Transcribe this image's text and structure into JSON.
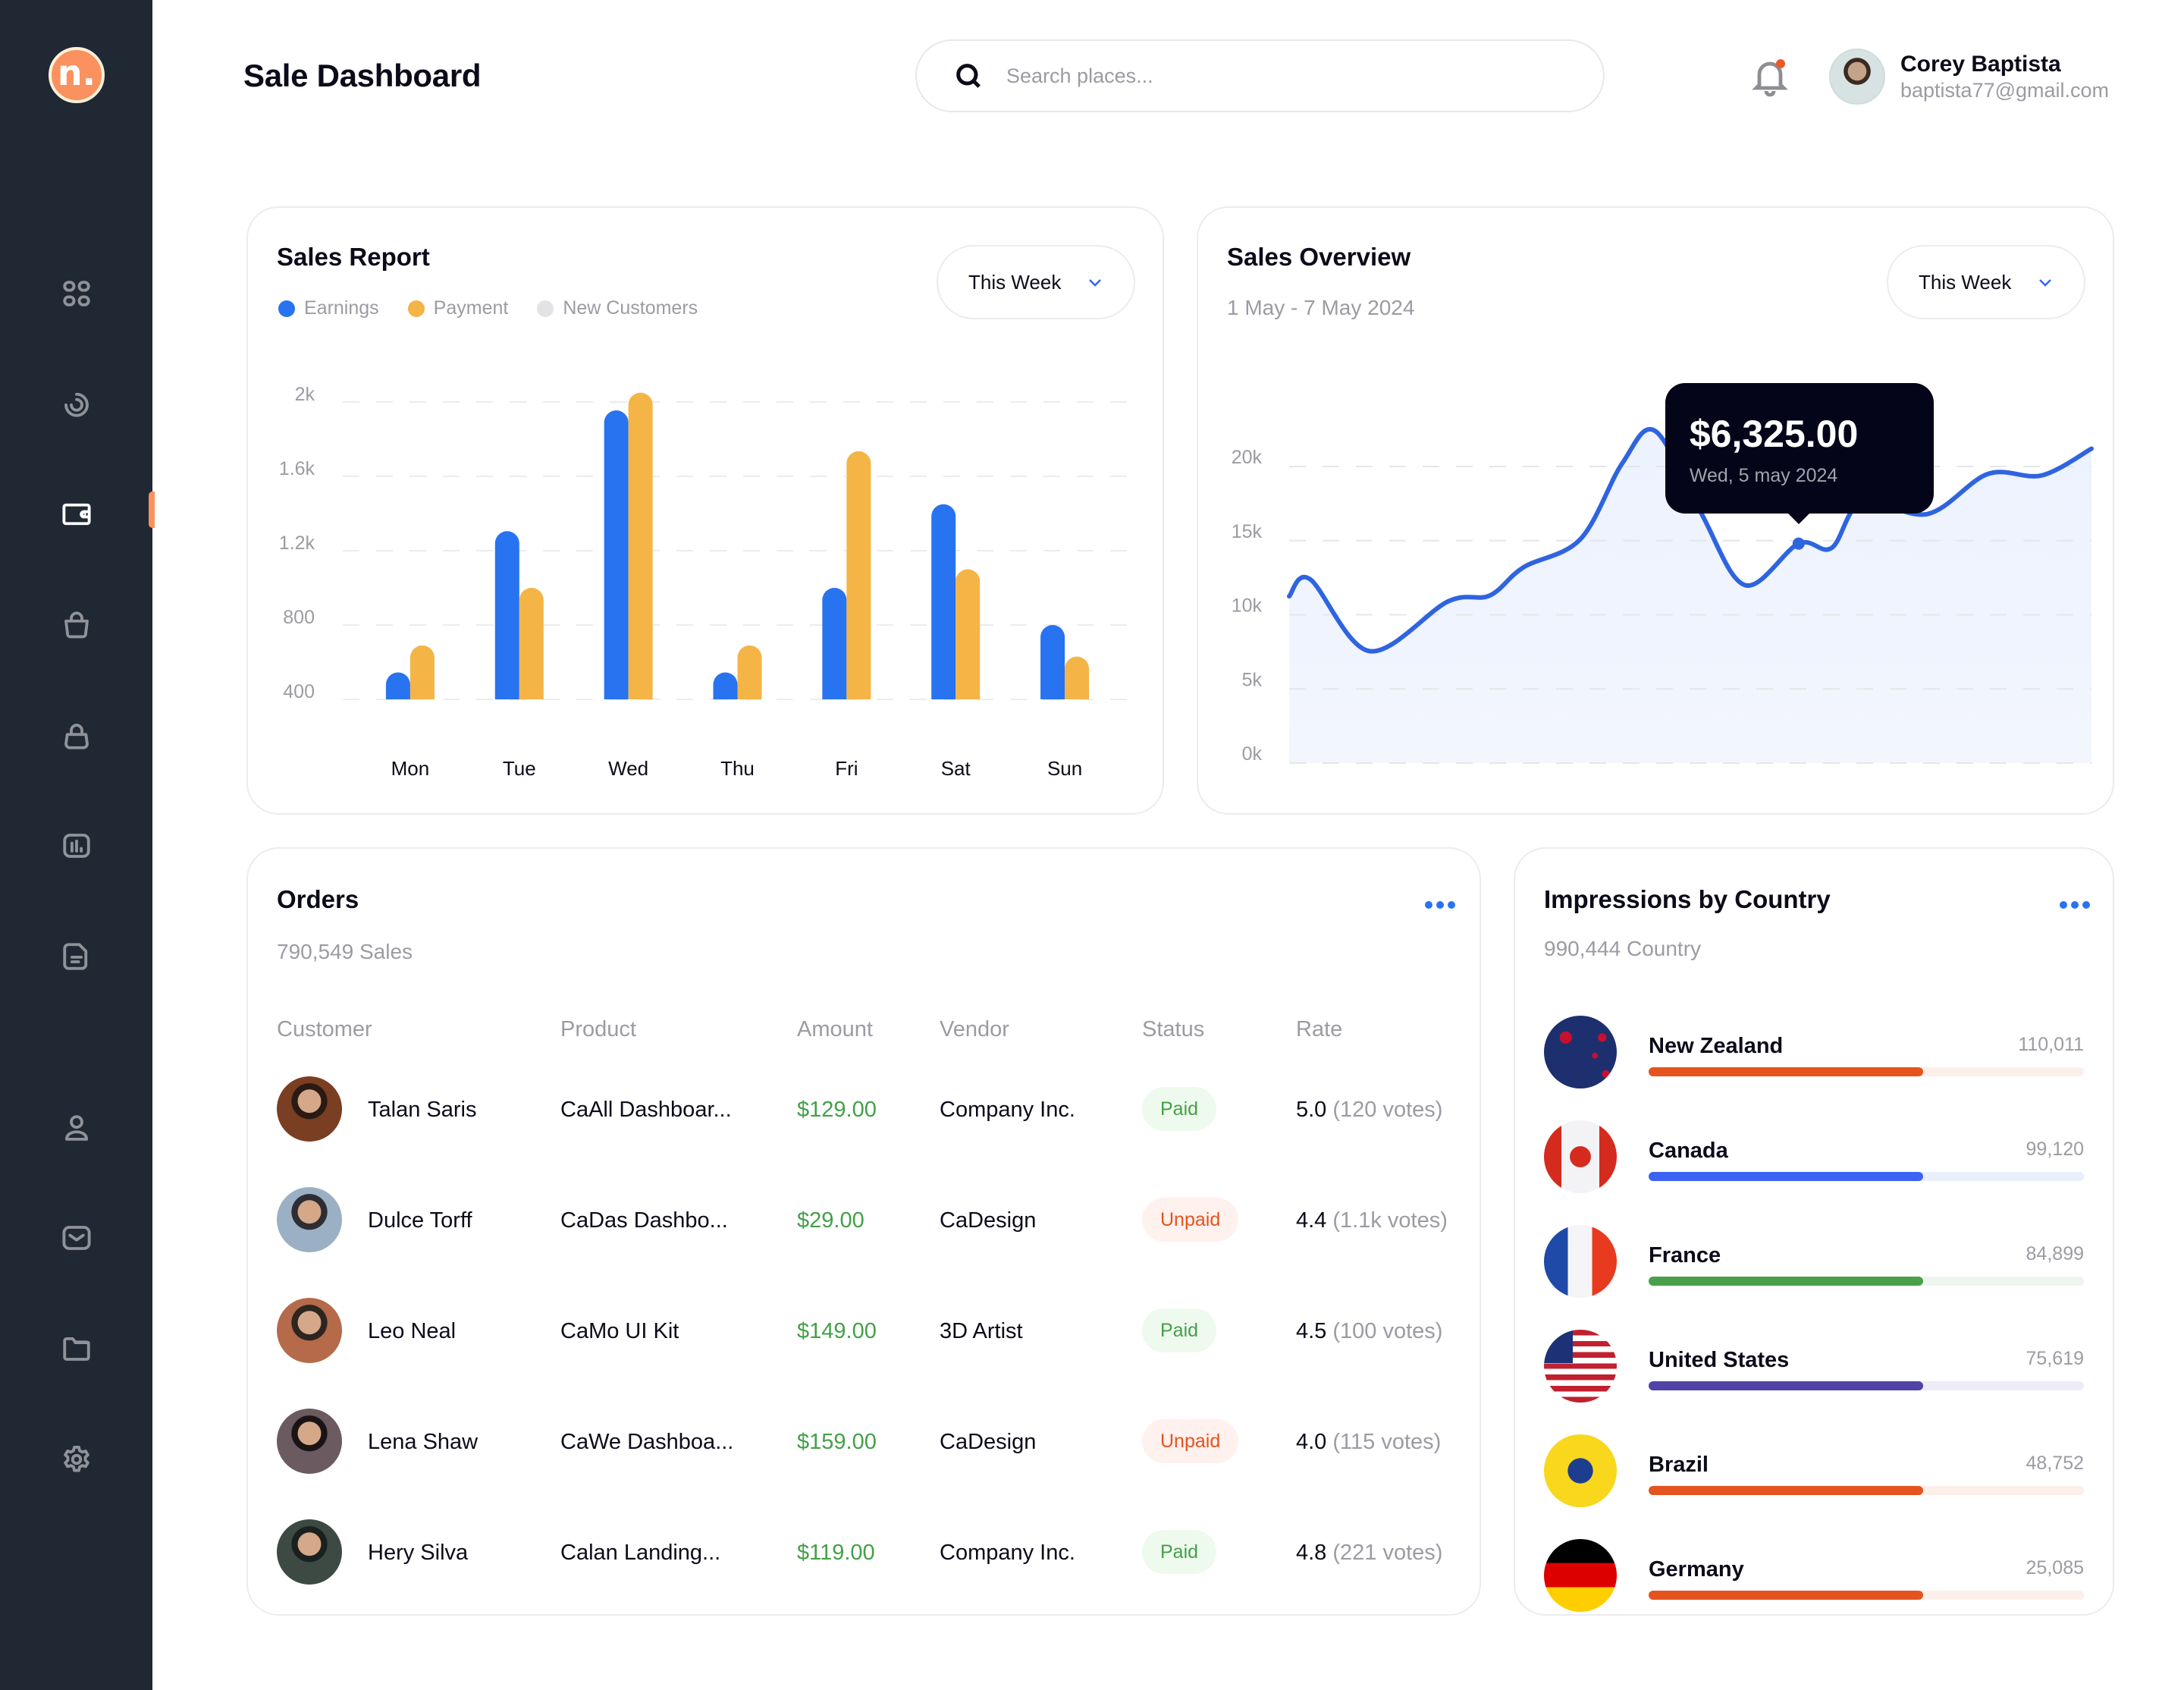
{
  "app": {
    "logo_letter": "n.",
    "page_title": "Sale Dashboard"
  },
  "colors": {
    "sidebar_bg": "#1f2833",
    "accent_orange": "#fa915f",
    "primary_blue": "#2873f0",
    "payment_orange": "#f4b446",
    "new_customers_gray": "#e3e3e6",
    "paid_green": "#43a047",
    "unpaid_red": "#e5531f",
    "tooltip_bg": "#05051a"
  },
  "sidebar": {
    "items": [
      {
        "name": "dashboard",
        "icon": "grid-icon",
        "active": false
      },
      {
        "name": "analytics",
        "icon": "spiral-icon",
        "active": false
      },
      {
        "name": "wallet",
        "icon": "wallet-icon",
        "active": true
      },
      {
        "name": "shop",
        "icon": "shopping-basket-icon",
        "active": false
      },
      {
        "name": "bag",
        "icon": "shopping-bag-icon",
        "active": false
      },
      {
        "name": "reports",
        "icon": "bar-chart-icon",
        "active": false
      },
      {
        "name": "documents",
        "icon": "document-icon",
        "active": false
      },
      {
        "name": "profile",
        "icon": "user-icon",
        "active": false
      },
      {
        "name": "messages",
        "icon": "mail-icon",
        "active": false
      },
      {
        "name": "files",
        "icon": "folder-icon",
        "active": false
      },
      {
        "name": "settings",
        "icon": "gear-icon",
        "active": false
      }
    ]
  },
  "header": {
    "search_placeholder": "Search places...",
    "search_value": "",
    "notification_unread": true,
    "user": {
      "name": "Corey Baptista",
      "email": "baptista77@gmail.com"
    }
  },
  "sales_report": {
    "title": "Sales Report",
    "period": "This Week",
    "legend": [
      {
        "label": "Earnings",
        "color": "#2873f0"
      },
      {
        "label": "Payment",
        "color": "#f4b446"
      },
      {
        "label": "New Customers",
        "color": "#e3e3e6"
      }
    ]
  },
  "sales_overview": {
    "title": "Sales Overview",
    "date_range": "1 May - 7 May 2024",
    "period": "This Week",
    "tooltip": {
      "value": "$6,325.00",
      "date": "Wed, 5 may 2024"
    }
  },
  "chart_data": [
    {
      "type": "bar",
      "title": "Sales Report",
      "categories": [
        "Mon",
        "Tue",
        "Wed",
        "Thu",
        "Fri",
        "Sat",
        "Sun"
      ],
      "series": [
        {
          "name": "Earnings",
          "color": "#2873f0",
          "values": [
            545,
            1305,
            1955,
            545,
            1000,
            1450,
            800
          ]
        },
        {
          "name": "Payment",
          "color": "#f4b446",
          "values": [
            690,
            1000,
            2050,
            690,
            1735,
            1100,
            630
          ]
        }
      ],
      "yticks": [
        "400",
        "800",
        "1.2k",
        "1.6k",
        "2k"
      ],
      "ytick_values": [
        400,
        800,
        1200,
        1600,
        2000
      ],
      "ylim": [
        400,
        2000
      ],
      "grid": true,
      "legend": "top-left",
      "xlabel": "",
      "ylabel": ""
    },
    {
      "type": "area",
      "title": "Sales Overview",
      "series": [
        {
          "name": "Sales",
          "color": "#2f64e0",
          "x": [
            0,
            0.026,
            0.1,
            0.198,
            0.25,
            0.292,
            0.363,
            0.415,
            0.456,
            0.512,
            0.568,
            0.635,
            0.676,
            0.714,
            0.796,
            0.871,
            0.938,
            1.0
          ],
          "values": [
            11250,
            12400,
            7550,
            10900,
            11300,
            13200,
            15100,
            20200,
            22400,
            17000,
            12000,
            14800,
            14500,
            17600,
            16800,
            19500,
            19400,
            21200
          ]
        }
      ],
      "highlight": {
        "index": 11,
        "label": "$6,325.00",
        "sublabel": "Wed, 5 may 2024"
      },
      "yticks": [
        "0k",
        "5k",
        "10k",
        "15k",
        "20k"
      ],
      "ytick_values": [
        0,
        5000,
        10000,
        15000,
        20000
      ],
      "ylim": [
        0,
        20000
      ],
      "grid": true
    }
  ],
  "orders": {
    "title": "Orders",
    "subtitle": "790,549 Sales",
    "columns": [
      "Customer",
      "Product",
      "Amount",
      "Vendor",
      "Status",
      "Rate"
    ],
    "rows": [
      {
        "customer": "Talan Saris",
        "product": "CaAll Dashboar...",
        "amount": "$129.00",
        "vendor": "Company Inc.",
        "status": "Paid",
        "rate": "5.0",
        "votes": "(120 votes)",
        "avatar_colors": [
          "#7a3e22",
          "#2a1a14"
        ]
      },
      {
        "customer": "Dulce Torff",
        "product": "CaDas Dashbo...",
        "amount": "$29.00",
        "vendor": "CaDesign",
        "status": "Unpaid",
        "rate": "4.4",
        "votes": "(1.1k votes)",
        "avatar_colors": [
          "#9bb0c4",
          "#2d2d33"
        ]
      },
      {
        "customer": "Leo Neal",
        "product": "CaMo UI Kit",
        "amount": "$149.00",
        "vendor": "3D Artist",
        "status": "Paid",
        "rate": "4.5",
        "votes": "(100 votes)",
        "avatar_colors": [
          "#b56a4a",
          "#2c2520"
        ]
      },
      {
        "customer": "Lena Shaw",
        "product": "CaWe Dashboa...",
        "amount": "$159.00",
        "vendor": "CaDesign",
        "status": "Unpaid",
        "rate": "4.0",
        "votes": "(115 votes)",
        "avatar_colors": [
          "#6b5a60",
          "#1b1416"
        ]
      },
      {
        "customer": "Hery Silva",
        "product": "Calan Landing...",
        "amount": "$119.00",
        "vendor": "Company Inc.",
        "status": "Paid",
        "rate": "4.8",
        "votes": "(221 votes)",
        "avatar_colors": [
          "#3d4a44",
          "#1a201d"
        ]
      }
    ]
  },
  "impressions": {
    "title": "Impressions by Country",
    "subtitle": "990,444 Country",
    "countries": [
      {
        "name": "New Zealand",
        "value": "110,011",
        "progress_pct": 63,
        "bar_color": "#e5531f",
        "track_color": "#fcefe9",
        "flag": "new-zealand"
      },
      {
        "name": "Canada",
        "value": "99,120",
        "progress_pct": 63,
        "bar_color": "#3d63f4",
        "track_color": "#e9effb",
        "flag": "canada"
      },
      {
        "name": "France",
        "value": "84,899",
        "progress_pct": 63,
        "bar_color": "#4aa04a",
        "track_color": "#edf5ec",
        "flag": "france"
      },
      {
        "name": "United States",
        "value": "75,619",
        "progress_pct": 63,
        "bar_color": "#5142a8",
        "track_color": "#edecf8",
        "flag": "united-states"
      },
      {
        "name": "Brazil",
        "value": "48,752",
        "progress_pct": 63,
        "bar_color": "#e5531f",
        "track_color": "#fcefe9",
        "flag": "brazil"
      },
      {
        "name": "Germany",
        "value": "25,085",
        "progress_pct": 63,
        "bar_color": "#e5531f",
        "track_color": "#fcefe9",
        "flag": "germany"
      }
    ]
  }
}
